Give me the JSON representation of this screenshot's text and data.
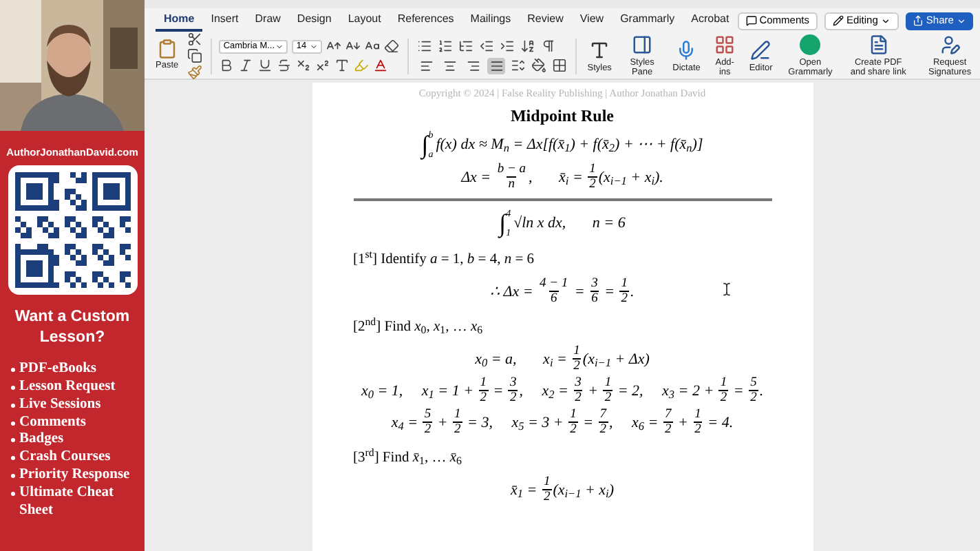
{
  "promo": {
    "website": "AuthorJonathanDavid.com",
    "heading": "Want a Custom Lesson?",
    "items": [
      "PDF-eBooks",
      "Lesson Request",
      "Live Sessions",
      "Comments",
      "Badges",
      "Crash Courses",
      "Priority Response",
      "Ultimate Cheat Sheet"
    ]
  },
  "tabs": [
    {
      "label": "Home",
      "selected": true
    },
    {
      "label": "Insert",
      "selected": false
    },
    {
      "label": "Draw",
      "selected": false
    },
    {
      "label": "Design",
      "selected": false
    },
    {
      "label": "Layout",
      "selected": false
    },
    {
      "label": "References",
      "selected": false
    },
    {
      "label": "Mailings",
      "selected": false
    },
    {
      "label": "Review",
      "selected": false
    },
    {
      "label": "View",
      "selected": false
    },
    {
      "label": "Grammarly",
      "selected": false
    },
    {
      "label": "Acrobat",
      "selected": false
    }
  ],
  "top_buttons": {
    "comments": "Comments",
    "editing": "Editing",
    "share": "Share"
  },
  "ribbon": {
    "paste": "Paste",
    "font": "Cambria M...",
    "size": "14",
    "alignment": [
      {
        "kind": "left",
        "selected": false
      },
      {
        "kind": "center",
        "selected": false
      },
      {
        "kind": "right",
        "selected": false
      },
      {
        "kind": "justify",
        "selected": true
      }
    ],
    "commands": [
      {
        "kind": "styles",
        "label": "Styles"
      },
      {
        "kind": "styles_pane",
        "label": "Styles Pane"
      },
      {
        "kind": "dictate",
        "label": "Dictate"
      },
      {
        "kind": "addins",
        "label": "Add-ins"
      },
      {
        "kind": "editor",
        "label": "Editor"
      },
      {
        "kind": "grammarly",
        "label": "Open Grammarly"
      },
      {
        "kind": "pdf",
        "label": "Create PDF and share link"
      },
      {
        "kind": "signatures",
        "label": "Request Signatures"
      }
    ]
  },
  "document": {
    "header": "Copyright © 2024 | False Reality Publishing | Author Jonathan David",
    "title": "Midpoint Rule",
    "blocks": [
      {
        "kind": "eq",
        "parts": [
          {
            "kind": "int",
            "sign": "∫",
            "lo": "a",
            "hi": "b"
          },
          {
            "kind": "t",
            "text": "f(x) dx ≈ M$_{n}$ = Δx[f(x̄$_{1}$) + f(x̄$_{2}$) + ⋯ + f(x̄$_{n}$)]"
          }
        ]
      },
      {
        "kind": "eq",
        "parts": [
          {
            "kind": "t",
            "text": "Δx = "
          },
          {
            "kind": "frac",
            "num": "b − a",
            "den": "n"
          },
          {
            "kind": "t",
            "text": ",       x̄$_{i}$ = "
          },
          {
            "kind": "frac",
            "num": "1",
            "den": "2"
          },
          {
            "kind": "t",
            "text": "(x$_{i−1}$ + x$_{i}$)."
          }
        ]
      },
      {
        "kind": "rule"
      },
      {
        "kind": "eq",
        "parts": [
          {
            "kind": "int",
            "sign": "∫",
            "lo": "1",
            "hi": "4"
          },
          {
            "kind": "t",
            "text": "√ln x dx,       n = 6"
          }
        ]
      },
      {
        "kind": "step",
        "label": "[1$^{st}$] Identify *a* = 1, *b* = 4, *n* = 6"
      },
      {
        "kind": "eq",
        "parts": [
          {
            "kind": "t",
            "text": "∴ Δx = "
          },
          {
            "kind": "frac",
            "num": "4 − 1",
            "den": "6"
          },
          {
            "kind": "t",
            "text": " = "
          },
          {
            "kind": "frac",
            "num": "3",
            "den": "6"
          },
          {
            "kind": "t",
            "text": " = "
          },
          {
            "kind": "frac",
            "num": "1",
            "den": "2"
          },
          {
            "kind": "t",
            "text": "."
          }
        ]
      },
      {
        "kind": "step",
        "label": "[2$^{nd}$] Find *x*$_{0}$, *x*$_{1}$, … *x*$_{6}$"
      },
      {
        "kind": "eq",
        "parts": [
          {
            "kind": "t",
            "text": "x$_{0}$ = a,       x$_{i}$ = "
          },
          {
            "kind": "frac",
            "num": "1",
            "den": "2"
          },
          {
            "kind": "t",
            "text": "(x$_{i−1}$ + Δx)"
          }
        ]
      },
      {
        "kind": "eq",
        "parts": [
          {
            "kind": "t",
            "text": "x$_{0}$ = 1,     x$_{1}$ = 1 + "
          },
          {
            "kind": "frac",
            "num": "1",
            "den": "2"
          },
          {
            "kind": "t",
            "text": " = "
          },
          {
            "kind": "frac",
            "num": "3",
            "den": "2"
          },
          {
            "kind": "t",
            "text": ",     x$_{2}$ = "
          },
          {
            "kind": "frac",
            "num": "3",
            "den": "2"
          },
          {
            "kind": "t",
            "text": " + "
          },
          {
            "kind": "frac",
            "num": "1",
            "den": "2"
          },
          {
            "kind": "t",
            "text": " = 2,     x$_{3}$ = 2 + "
          },
          {
            "kind": "frac",
            "num": "1",
            "den": "2"
          },
          {
            "kind": "t",
            "text": " = "
          },
          {
            "kind": "frac",
            "num": "5",
            "den": "2"
          },
          {
            "kind": "t",
            "text": "."
          }
        ]
      },
      {
        "kind": "eq",
        "parts": [
          {
            "kind": "t",
            "text": "x$_{4}$ = "
          },
          {
            "kind": "frac",
            "num": "5",
            "den": "2"
          },
          {
            "kind": "t",
            "text": " + "
          },
          {
            "kind": "frac",
            "num": "1",
            "den": "2"
          },
          {
            "kind": "t",
            "text": " = 3,     x$_{5}$ = 3 + "
          },
          {
            "kind": "frac",
            "num": "1",
            "den": "2"
          },
          {
            "kind": "t",
            "text": " = "
          },
          {
            "kind": "frac",
            "num": "7",
            "den": "2"
          },
          {
            "kind": "t",
            "text": ",     x$_{6}$ = "
          },
          {
            "kind": "frac",
            "num": "7",
            "den": "2"
          },
          {
            "kind": "t",
            "text": " + "
          },
          {
            "kind": "frac",
            "num": "1",
            "den": "2"
          },
          {
            "kind": "t",
            "text": " = 4."
          }
        ]
      },
      {
        "kind": "step",
        "label": "[3$^{rd}$] Find *x̄*$_{1}$, … *x̄*$_{6}$"
      },
      {
        "kind": "eq",
        "parts": [
          {
            "kind": "t",
            "text": "x̄$_{1}$ = "
          },
          {
            "kind": "frac",
            "num": "1",
            "den": "2"
          },
          {
            "kind": "t",
            "text": "(x$_{i−1}$ + x$_{i}$)"
          }
        ]
      }
    ]
  }
}
